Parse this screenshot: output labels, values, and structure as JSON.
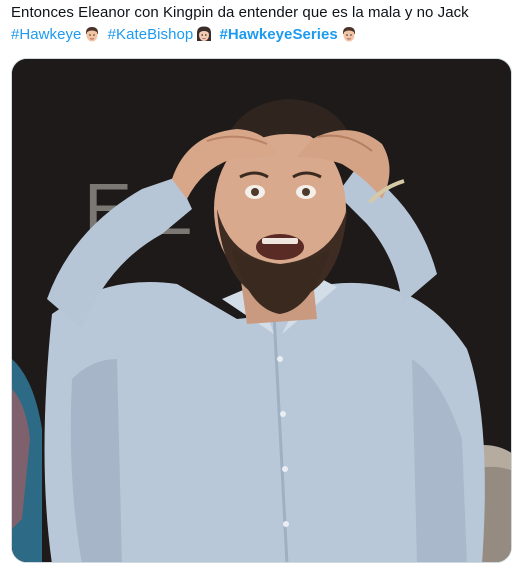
{
  "tweet": {
    "text": "Entonces Eleanor con Kingpin da entender que es la mala y no Jack",
    "hashtags": [
      {
        "label": "#Hawkeye",
        "emoji": "man-face-emoji"
      },
      {
        "label": "#KateBishop",
        "emoji": "woman-archer-emoji"
      },
      {
        "label": "#HawkeyeSeries",
        "emoji": "man-face-emoji"
      }
    ]
  },
  "media": {
    "background_letters": "E L",
    "accent_color": "#1d9bf0"
  }
}
